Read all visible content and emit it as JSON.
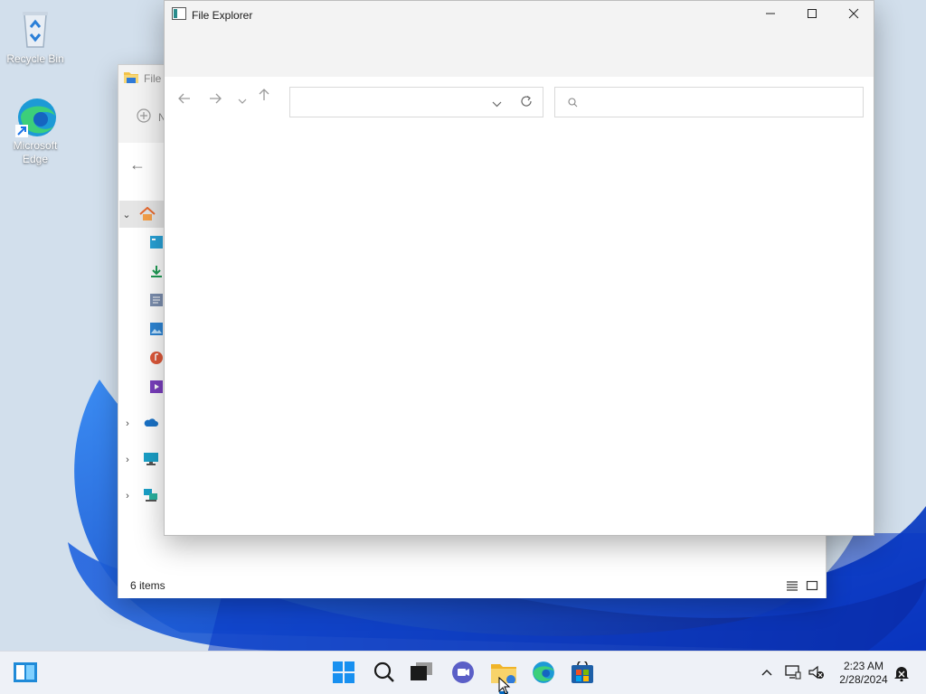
{
  "desktop": {
    "icons": [
      {
        "label": "Recycle Bin"
      },
      {
        "label": "Microsoft Edge"
      }
    ]
  },
  "back_window": {
    "title": "File E",
    "new_label": "N",
    "status": {
      "item_count": "6 items"
    }
  },
  "front_window": {
    "title": "File Explorer",
    "address": {
      "value": "",
      "placeholder": ""
    },
    "search": {
      "value": "",
      "placeholder": ""
    }
  },
  "taskbar": {
    "clock": {
      "time": "2:23 AM",
      "date": "2/28/2024"
    },
    "apps": [
      "widgets-icon",
      "start-icon",
      "search-icon",
      "task-view-icon",
      "chat-icon",
      "file-explorer-icon",
      "edge-icon",
      "store-icon"
    ]
  },
  "colors": {
    "accent": "#0067c0",
    "taskbar_bg": "#eef1f7",
    "window_chrome": "#f3f3f3"
  }
}
